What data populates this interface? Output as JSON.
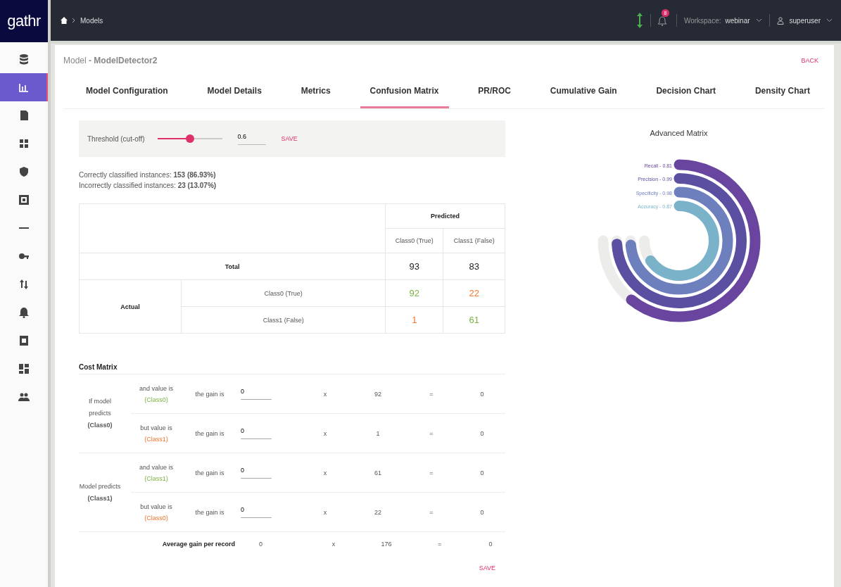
{
  "logo": "gathr",
  "sidebar": {
    "items": [
      {
        "kind": "database",
        "selected": false
      },
      {
        "kind": "chart",
        "selected": true
      },
      {
        "kind": "file",
        "selected": false
      },
      {
        "kind": "grid",
        "selected": false
      },
      {
        "kind": "shield",
        "selected": false
      },
      {
        "kind": "frame",
        "selected": false
      },
      {
        "kind": "dash",
        "selected": false
      },
      {
        "kind": "key",
        "selected": false
      },
      {
        "kind": "arrows",
        "selected": false
      },
      {
        "kind": "bell",
        "selected": false
      },
      {
        "kind": "doc",
        "selected": false
      },
      {
        "kind": "dashboard",
        "selected": false
      },
      {
        "kind": "people",
        "selected": false
      }
    ]
  },
  "header": {
    "breadcrumb": "Models",
    "notification_badge": "8",
    "workspace_label": "Workspace:",
    "workspace": "webinar",
    "user": "superuser"
  },
  "page": {
    "title": "Model **- ModelDetector2**",
    "back": "BACK"
  },
  "tabs": [
    {
      "label": "Model Configuration",
      "selected": false
    },
    {
      "label": "Model Details",
      "selected": false
    },
    {
      "label": "Metrics",
      "selected": false
    },
    {
      "label": "Confusion Matrix",
      "selected": true
    },
    {
      "label": "PR/ROC",
      "selected": false
    },
    {
      "label": "Cumulative Gain",
      "selected": false
    },
    {
      "label": "Decision Chart",
      "selected": false
    },
    {
      "label": "Density Chart",
      "selected": false
    }
  ],
  "threshold": {
    "label": "Threshold (cut-off)",
    "level": 0.5,
    "value": "0.6",
    "save": "SAVE"
  },
  "summary": [
    "Correctly classified instances: **153 (86.93%)**",
    "Incorrectly classified instances: **23 (13.07%)**"
  ],
  "confusion_matrix": {
    "predicted": "Predicted",
    "classes": [
      "Class0 (True)",
      "Class1 (False)"
    ],
    "total_label": "Total",
    "totals": [
      "93",
      "83"
    ],
    "actual": "Actual",
    "rows": [
      {
        "label": "Class0 (True)",
        "cells": [
          {
            "value": "92",
            "kind": "correct"
          },
          {
            "value": "22",
            "kind": "wrong"
          }
        ]
      },
      {
        "label": "Class1 (False)",
        "cells": [
          {
            "value": "1",
            "kind": "wrong"
          },
          {
            "value": "61",
            "kind": "correct"
          }
        ]
      }
    ]
  },
  "cost_matrix": {
    "title": "Cost Matrix",
    "groups": [
      {
        "label": "If model predicts **(Class0)**",
        "rows": [
          {
            "condition": "and value is",
            "class": "(Class0)",
            "kind": "correct",
            "gain_label": "the gain is",
            "gain": "0",
            "times": "x",
            "count": "92",
            "equals": "=",
            "result": "0"
          },
          {
            "condition": "but value is",
            "class": "(Class1)",
            "kind": "wrong",
            "gain_label": "the gain is",
            "gain": "0",
            "times": "x",
            "count": "1",
            "equals": "=",
            "result": "0"
          }
        ]
      },
      {
        "label": "Model predicts **(Class1)**",
        "rows": [
          {
            "condition": "and value is",
            "class": "(Class1)",
            "kind": "correct",
            "gain_label": "the gain is",
            "gain": "0",
            "times": "x",
            "count": "61",
            "equals": "=",
            "result": "0"
          },
          {
            "condition": "but value is",
            "class": "(Class0)",
            "kind": "wrong",
            "gain_label": "the gain is",
            "gain": "0",
            "times": "x",
            "count": "22",
            "equals": "=",
            "result": "0"
          }
        ]
      }
    ],
    "average": {
      "label": "Average gain per record",
      "gain": "0",
      "times": "x",
      "count": "176",
      "equals": "=",
      "result": "0"
    },
    "save": "SAVE"
  },
  "advanced_matrix": {
    "title": "Advanced Matrix",
    "metrics": [
      {
        "label": "Recall - 0.81",
        "color": "#6a45a0"
      },
      {
        "label": "Precision - 0.99",
        "color": "#5a4fa0"
      },
      {
        "label": "Specificity - 0.98",
        "color": "#6e7fbd"
      },
      {
        "label": "Accuracy - 0.87",
        "color": "#7ab3c9"
      }
    ]
  }
}
